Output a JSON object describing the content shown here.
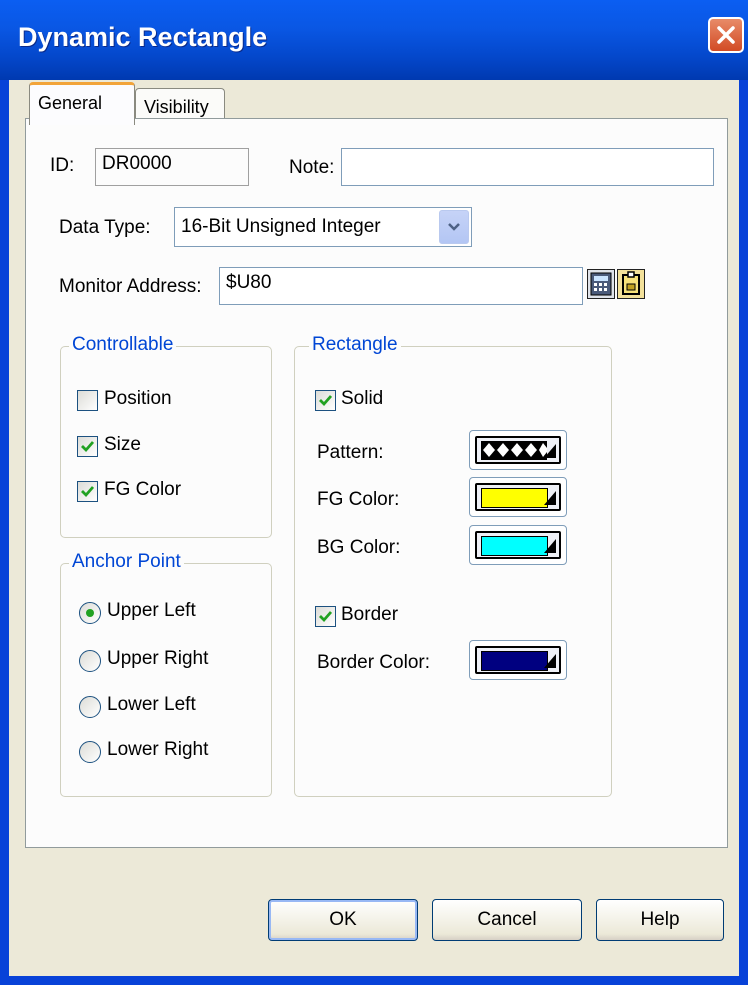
{
  "window": {
    "title": "Dynamic Rectangle",
    "close_icon": "close-icon"
  },
  "tabs": [
    {
      "label": "General",
      "active": true
    },
    {
      "label": "Visibility",
      "active": false
    }
  ],
  "general": {
    "id_label": "ID:",
    "id_value": "DR0000",
    "note_label": "Note:",
    "note_value": "",
    "data_type_label": "Data Type:",
    "data_type_value": "16-Bit Unsigned Integer",
    "monitor_address_label": "Monitor Address:",
    "monitor_address_value": "$U80"
  },
  "controllable": {
    "title": "Controllable",
    "items": [
      {
        "label": "Position",
        "checked": false
      },
      {
        "label": "Size",
        "checked": true
      },
      {
        "label": "FG Color",
        "checked": true
      }
    ]
  },
  "anchor": {
    "title": "Anchor Point",
    "selected": "Upper Left",
    "options": [
      "Upper Left",
      "Upper Right",
      "Lower Left",
      "Lower Right"
    ]
  },
  "rectangle": {
    "title": "Rectangle",
    "solid_label": "Solid",
    "solid_checked": true,
    "pattern_label": "Pattern:",
    "fg_color_label": "FG Color:",
    "fg_color": "#ffff00",
    "bg_color_label": "BG Color:",
    "bg_color": "#00ffff",
    "border_label": "Border",
    "border_checked": true,
    "border_color_label": "Border Color:",
    "border_color": "#000080"
  },
  "buttons": {
    "ok": "OK",
    "cancel": "Cancel",
    "help": "Help"
  },
  "colors": {
    "titlebar": "#0a57e4",
    "dialog_bg": "#ece9d8",
    "group_title": "#0046d5"
  }
}
